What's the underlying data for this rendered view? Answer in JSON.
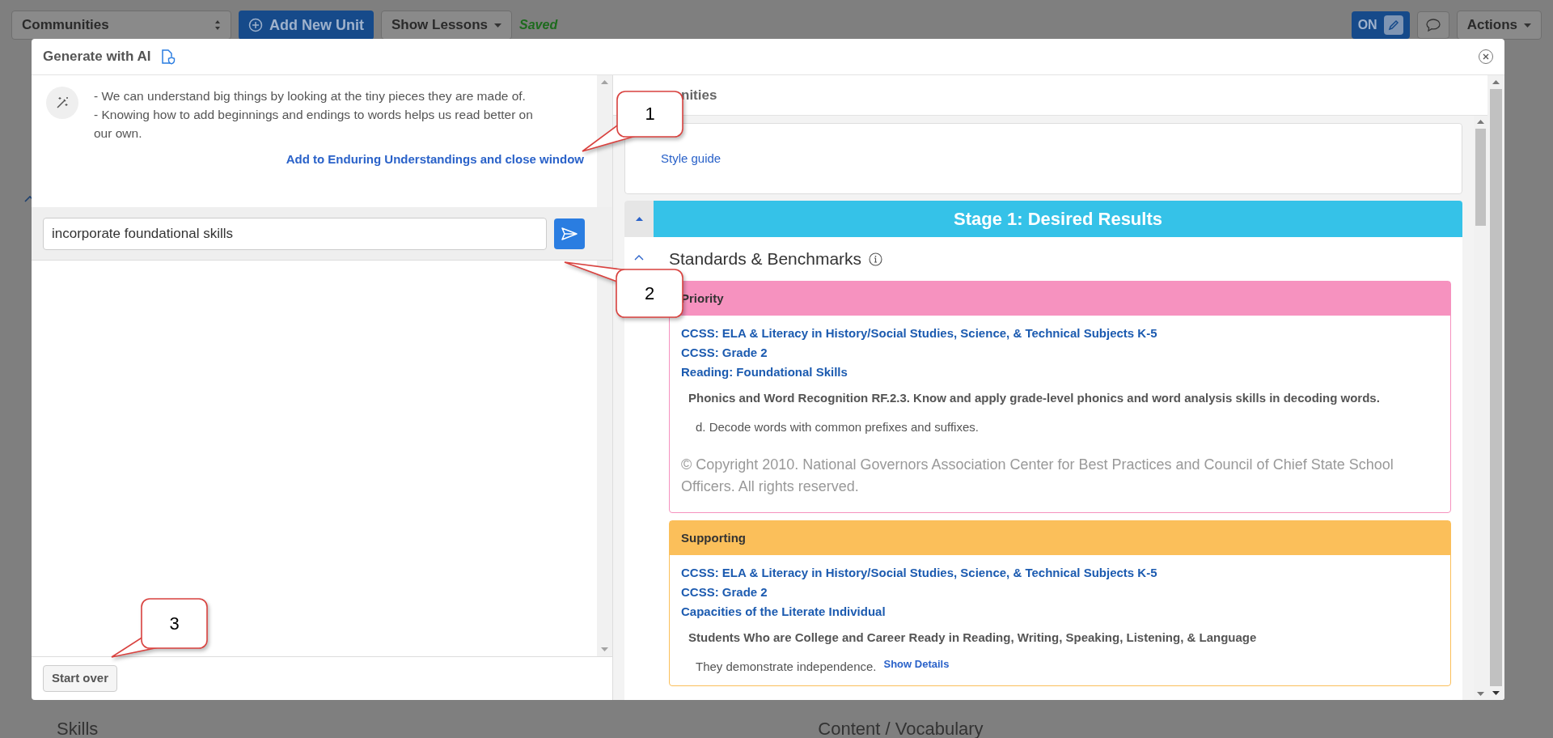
{
  "toolbar": {
    "unit_select": "Communities",
    "add_button": "Add New Unit",
    "lessons_button": "Show Lessons",
    "save_status": "Saved",
    "toggle_label": "ON",
    "actions_button": "Actions"
  },
  "background_headings": [
    "Skills",
    "Content / Vocabulary"
  ],
  "modal": {
    "title": "Generate with AI",
    "assistant_message": [
      "- We can understand big things by looking at the tiny pieces they are made of.",
      "- Knowing how to add beginnings and endings to words helps us read better on our own."
    ],
    "add_link": "Add to Enduring Understandings and close window",
    "prompt_input": "incorporate foundational skills",
    "start_over": "Start over"
  },
  "document": {
    "title_fragment": "nities",
    "style_guide": "Style guide",
    "stage_title": "Stage 1: Desired Results",
    "section_title": "Standards & Benchmarks",
    "standard_groups": [
      {
        "label": "Priority",
        "color": "#f692bf",
        "links": [
          "CCSS: ELA & Literacy in History/Social Studies, Science, & Technical Subjects K-5",
          "CCSS: Grade 2",
          "Reading: Foundational Skills"
        ],
        "standard": "Phonics and Word Recognition RF.2.3. Know and apply grade-level phonics and word analysis skills in decoding words.",
        "detail": "d. Decode words with common prefixes and suffixes.",
        "copyright": "© Copyright 2010. National Governors Association Center for Best Practices and Council of Chief State School Officers. All rights reserved."
      },
      {
        "label": "Supporting",
        "color": "#fbbf5a",
        "links": [
          "CCSS: ELA & Literacy in History/Social Studies, Science, & Technical Subjects K-5",
          "CCSS: Grade 2",
          "Capacities of the Literate Individual"
        ],
        "standard": "Students Who are College and Career Ready in Reading, Writing, Speaking, Listening, & Language",
        "detail": "They demonstrate independence.",
        "show_details": "Show Details"
      }
    ]
  },
  "callouts": [
    "1",
    "2",
    "3"
  ]
}
